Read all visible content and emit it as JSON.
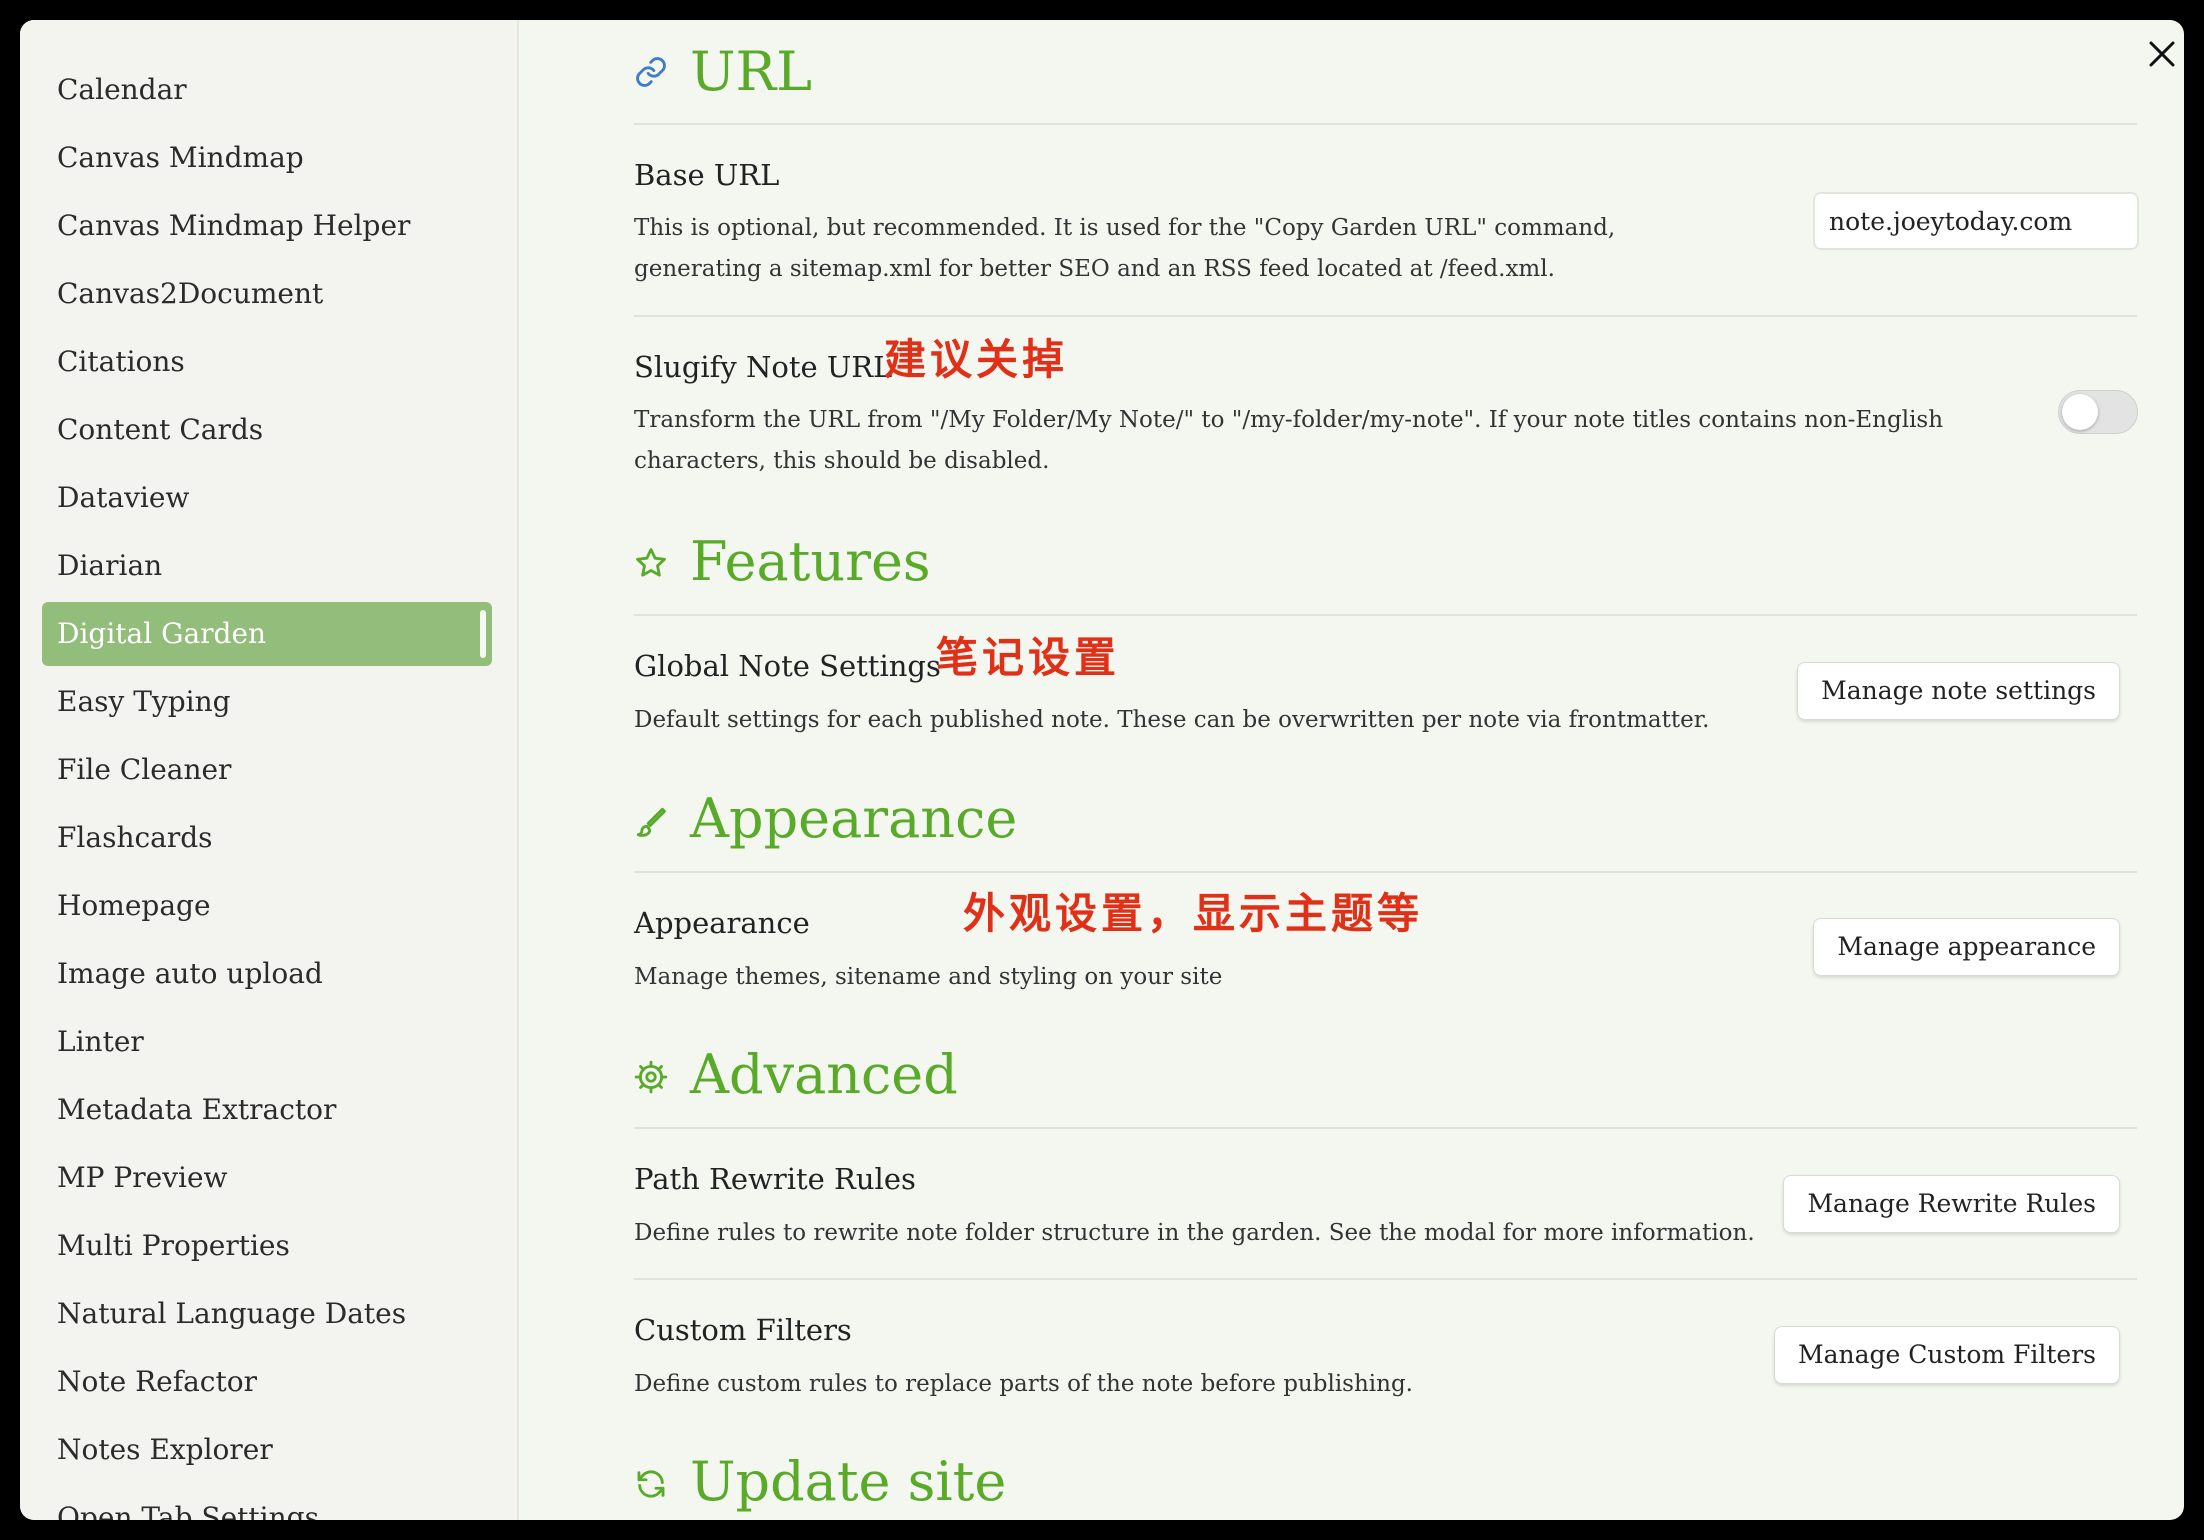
{
  "sidebar": {
    "items": [
      {
        "label": "Calendar"
      },
      {
        "label": "Canvas Mindmap"
      },
      {
        "label": "Canvas Mindmap Helper"
      },
      {
        "label": "Canvas2Document"
      },
      {
        "label": "Citations"
      },
      {
        "label": "Content Cards"
      },
      {
        "label": "Dataview"
      },
      {
        "label": "Diarian"
      },
      {
        "label": "Digital Garden",
        "active": true
      },
      {
        "label": "Easy Typing"
      },
      {
        "label": "File Cleaner"
      },
      {
        "label": "Flashcards"
      },
      {
        "label": "Homepage"
      },
      {
        "label": "Image auto upload"
      },
      {
        "label": "Linter"
      },
      {
        "label": "Metadata Extractor"
      },
      {
        "label": "MP Preview"
      },
      {
        "label": "Multi Properties"
      },
      {
        "label": "Natural Language Dates"
      },
      {
        "label": "Note Refactor"
      },
      {
        "label": "Notes Explorer"
      },
      {
        "label": "Open Tab Settings"
      }
    ]
  },
  "sections": {
    "url": {
      "title": "URL",
      "icon": "link-icon",
      "base_url": {
        "name": "Base URL",
        "desc": "This is optional, but recommended. It is used for the \"Copy Garden URL\" command, generating a sitemap.xml for better SEO and an RSS feed located at /feed.xml.",
        "value": "note.joeytoday.com"
      },
      "slugify": {
        "name": "Slugify Note URL",
        "desc": "Transform the URL from \"/My Folder/My Note/\" to \"/my-folder/my-note\". If your note titles contains non-English characters, this should be disabled.",
        "enabled": false,
        "annotation": "建议关掉"
      }
    },
    "features": {
      "title": "Features",
      "icon": "star-icon",
      "global_note": {
        "name": "Global Note Settings",
        "desc": "Default settings for each published note. These can be overwritten per note via frontmatter.",
        "button": "Manage note settings",
        "annotation": "笔记设置"
      }
    },
    "appearance": {
      "title": "Appearance",
      "icon": "brush-icon",
      "appearance": {
        "name": "Appearance",
        "desc": "Manage themes, sitename and styling on your site",
        "button": "Manage appearance",
        "annotation": "外观设置，显示主题等"
      }
    },
    "advanced": {
      "title": "Advanced",
      "icon": "gear-icon",
      "path_rewrite": {
        "name": "Path Rewrite Rules",
        "desc": "Define rules to rewrite note folder structure in the garden. See the modal for more information.",
        "button": "Manage Rewrite Rules"
      },
      "custom_filters": {
        "name": "Custom Filters",
        "desc": "Define custom rules to replace parts of the note before publishing.",
        "button": "Manage Custom Filters"
      }
    },
    "update_site": {
      "title": "Update site",
      "icon": "refresh-icon"
    }
  },
  "colors": {
    "accent": "#5aaa2a",
    "active_item": "#93bd7b",
    "annotation": "#e03018"
  }
}
